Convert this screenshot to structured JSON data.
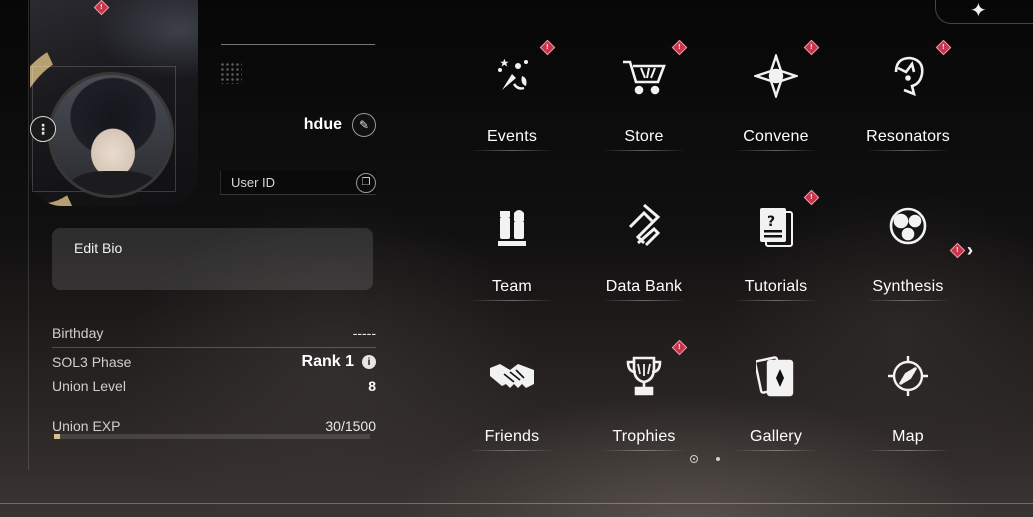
{
  "profile": {
    "name": "hdue",
    "user_id_label": "User ID",
    "bio_placeholder": "Edit Bio",
    "stats": {
      "birthday_label": "Birthday",
      "birthday_value": "-----",
      "phase_label": "SOL3 Phase",
      "phase_value": "Rank 1",
      "union_level_label": "Union Level",
      "union_level_value": "8",
      "union_exp_label": "Union EXP",
      "union_exp_value": "30/1500",
      "union_exp_fraction": 0.02
    }
  },
  "menu": {
    "rows": [
      [
        {
          "label": "Events",
          "icon": "fireworks-icon",
          "badge": true
        },
        {
          "label": "Store",
          "icon": "cart-icon",
          "badge": true
        },
        {
          "label": "Convene",
          "icon": "compass-star-icon",
          "badge": true
        },
        {
          "label": "Resonators",
          "icon": "character-head-icon",
          "badge": true
        }
      ],
      [
        {
          "label": "Team",
          "icon": "chess-pieces-icon",
          "badge": false
        },
        {
          "label": "Data Bank",
          "icon": "data-bank-icon",
          "badge": false
        },
        {
          "label": "Tutorials",
          "icon": "tutorial-doc-icon",
          "badge": true
        },
        {
          "label": "Synthesis",
          "icon": "synthesis-icon",
          "badge": false
        }
      ],
      [
        {
          "label": "Friends",
          "icon": "handshake-icon",
          "badge": false
        },
        {
          "label": "Trophies",
          "icon": "trophy-icon",
          "badge": true
        },
        {
          "label": "Gallery",
          "icon": "cards-icon",
          "badge": false
        },
        {
          "label": "Map",
          "icon": "map-compass-icon",
          "badge": false
        }
      ]
    ],
    "badge_mark": "!",
    "next_page_badge": true
  },
  "pager": {
    "pages": 2,
    "current": 1
  },
  "colors": {
    "badge_red": "#c9344a",
    "exp_gold": "#d8c08a",
    "banner_gold": "#c9b07a"
  }
}
